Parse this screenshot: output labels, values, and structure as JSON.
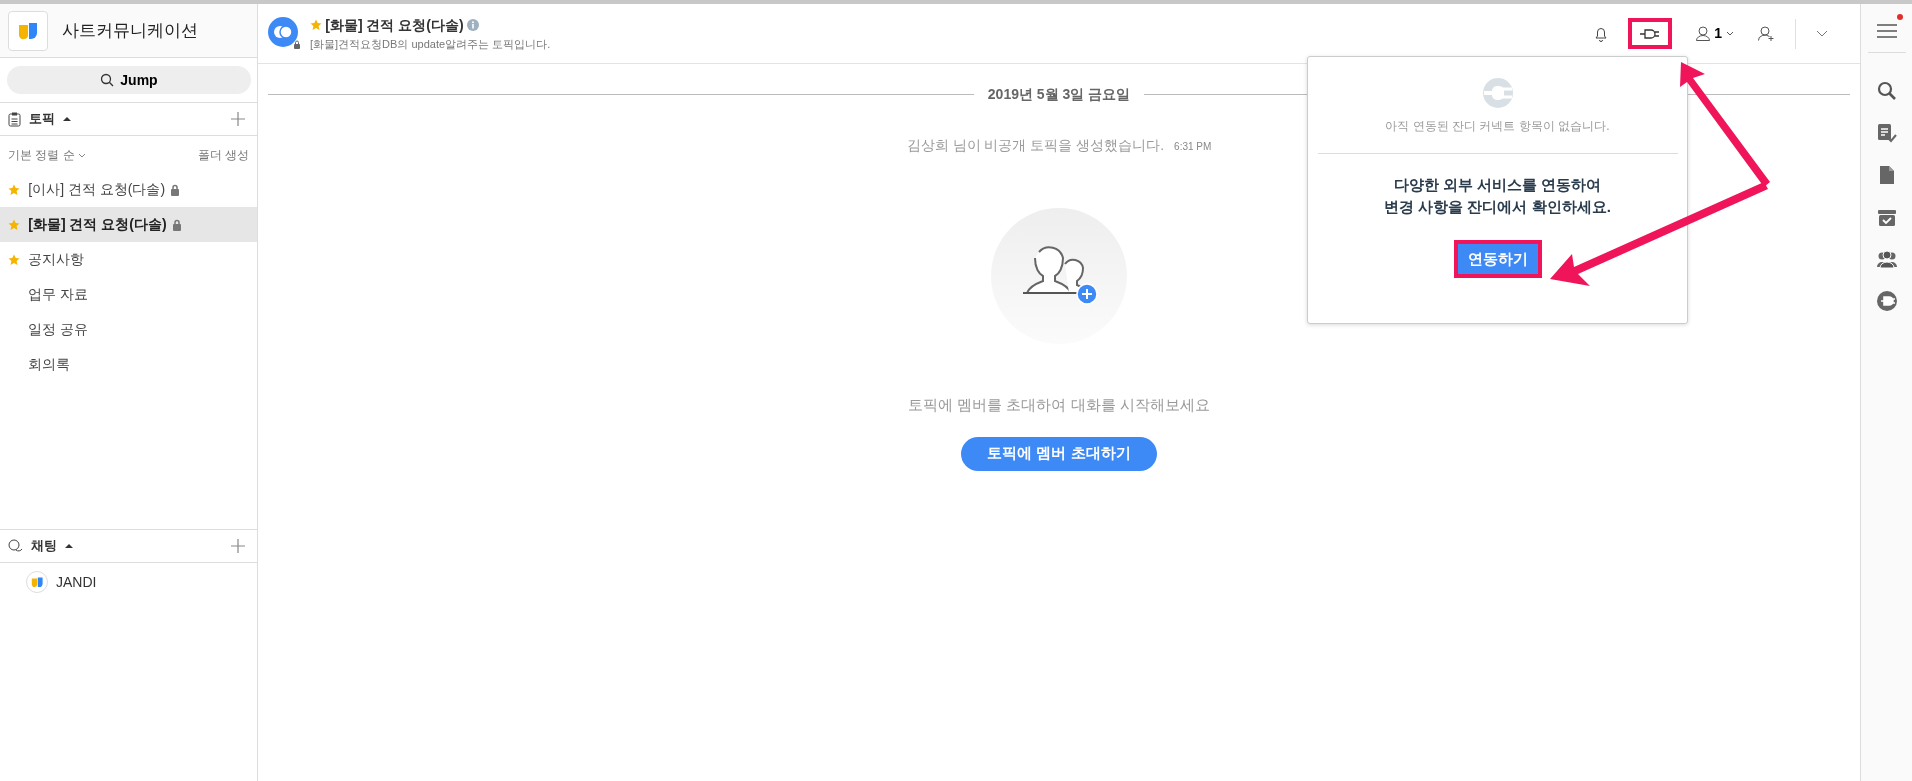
{
  "workspace": {
    "name": "사트커뮤니케이션"
  },
  "jump": {
    "label": "Jump"
  },
  "topics": {
    "title": "토픽",
    "sort": "기본 정렬 순",
    "create_folder": "폴더 생성",
    "items": [
      {
        "label": "[이사] 견적 요청(다솔)",
        "starred": true,
        "locked": true,
        "selected": false
      },
      {
        "label": "[화물] 견적 요청(다솔)",
        "starred": true,
        "locked": true,
        "selected": true
      },
      {
        "label": "공지사항",
        "starred": true,
        "locked": false,
        "selected": false
      },
      {
        "label": "업무 자료",
        "starred": false,
        "locked": false,
        "selected": false
      },
      {
        "label": "일정 공유",
        "starred": false,
        "locked": false,
        "selected": false
      },
      {
        "label": "회의록",
        "starred": false,
        "locked": false,
        "selected": false
      }
    ]
  },
  "chats": {
    "title": "채팅",
    "items": [
      {
        "label": "JANDI"
      }
    ]
  },
  "header": {
    "title": "[화물] 견적 요청(다솔)",
    "starred": true,
    "description": "[화물]견적요청DB의 update알려주는 토픽입니다.",
    "member_count": "1"
  },
  "messages": {
    "date": "2019년 5월 3일 금요일",
    "system": "김상희 님이 비공개 토픽을 생성했습니다.",
    "time": "6:31 PM"
  },
  "empty_state": {
    "text": "토픽에 멤버를 초대하여 대화를 시작해보세요",
    "button": "토픽에 멤버 초대하기"
  },
  "connect_popup": {
    "empty": "아직 연동된 잔디 커넥트 항목이 없습니다.",
    "lines": [
      "다양한 외부 서비스를 연동하여",
      "변경 사항을 잔디에서 확인하세요."
    ],
    "button": "연동하기"
  },
  "rail": {
    "notification_dot": true
  }
}
